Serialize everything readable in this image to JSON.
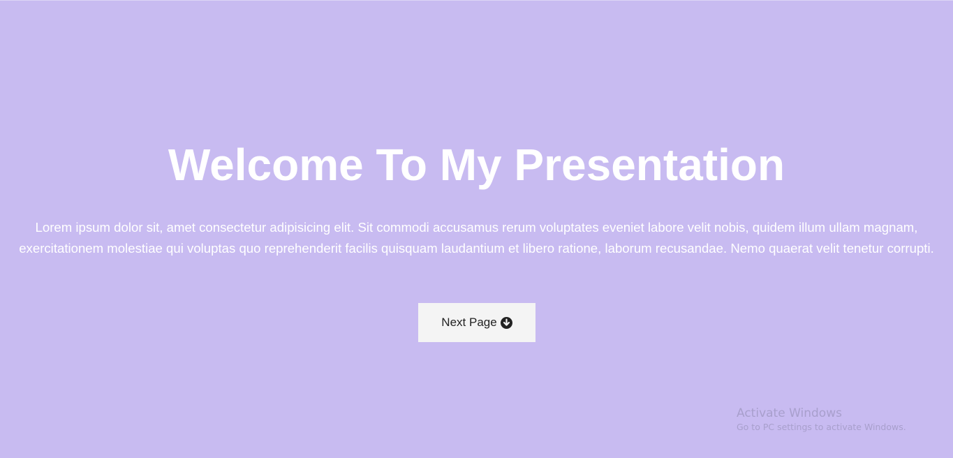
{
  "page": {
    "background_color": "#c8bbf1",
    "text_color": "#ffffff"
  },
  "hero": {
    "title": "Welcome To My Presentation",
    "body": "Lorem ipsum dolor sit, amet consectetur adipisicing elit. Sit commodi accusamus rerum voluptates eveniet labore velit nobis, quidem illum ullam magnam, exercitationem molestiae qui voluptas quo reprehenderit facilis quisquam laudantium et libero ratione, laborum recusandae. Nemo quaerat velit tenetur corrupti.",
    "button": {
      "label": "Next Page",
      "icon": "arrow-circle-down-icon",
      "background_color": "#f4f4f4"
    }
  },
  "os_watermark": {
    "title": "Activate Windows",
    "subtitle": "Go to PC settings to activate Windows."
  }
}
